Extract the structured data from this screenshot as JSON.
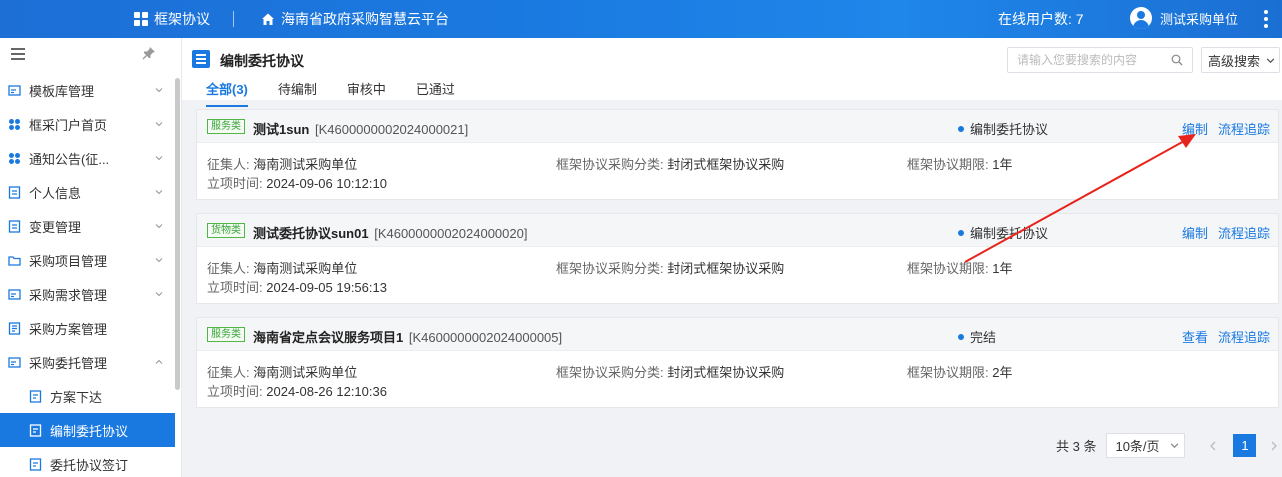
{
  "topbar": {
    "app_name": "框架协议",
    "platform_name": "海南省政府采购智慧云平台",
    "online_users": "在线用户数: 7",
    "user_name": "测试采购单位"
  },
  "sidebar": {
    "items": [
      {
        "label": "模板库管理"
      },
      {
        "label": "框采门户首页"
      },
      {
        "label": "通知公告(征..."
      },
      {
        "label": "个人信息"
      },
      {
        "label": "变更管理"
      },
      {
        "label": "采购项目管理"
      },
      {
        "label": "采购需求管理"
      },
      {
        "label": "采购方案管理"
      },
      {
        "label": "采购委托管理"
      },
      {
        "label": "方案下达"
      },
      {
        "label": "编制委托协议"
      },
      {
        "label": "委托协议签订"
      }
    ]
  },
  "page": {
    "title": "编制委托协议",
    "tabs": [
      "全部(3)",
      "待编制",
      "审核中",
      "已通过"
    ],
    "search_placeholder": "请输入您要搜索的内容",
    "advanced_search": "高级搜索"
  },
  "records": [
    {
      "tag": "服务类",
      "name": "测试1sun",
      "code": "[K4600000002024000021]",
      "status": "编制委托协议",
      "action1": "编制",
      "action2": "流程追踪",
      "collector_label": "征集人:",
      "collector": "海南测试采购单位",
      "category_label": "框架协议采购分类:",
      "category": "封闭式框架协议采购",
      "period_label": "框架协议期限:",
      "period": "1年",
      "time_label": "立项时间:",
      "time": "2024-09-06 10:12:10"
    },
    {
      "tag": "货物类",
      "name": "测试委托协议sun01",
      "code": "[K4600000002024000020]",
      "status": "编制委托协议",
      "action1": "编制",
      "action2": "流程追踪",
      "collector_label": "征集人:",
      "collector": "海南测试采购单位",
      "category_label": "框架协议采购分类:",
      "category": "封闭式框架协议采购",
      "period_label": "框架协议期限:",
      "period": "1年",
      "time_label": "立项时间:",
      "time": "2024-09-05 19:56:13"
    },
    {
      "tag": "服务类",
      "name": "海南省定点会议服务项目1",
      "code": "[K4600000002024000005]",
      "status": "完结",
      "action1": "查看",
      "action2": "流程追踪",
      "collector_label": "征集人:",
      "collector": "海南测试采购单位",
      "category_label": "框架协议采购分类:",
      "category": "封闭式框架协议采购",
      "period_label": "框架协议期限:",
      "period": "2年",
      "time_label": "立项时间:",
      "time": "2024-08-26 12:10:36"
    }
  ],
  "pager": {
    "total": "共 3 条",
    "page_size": "10条/页",
    "current": "1"
  },
  "colors": {
    "primary": "#1a79e0",
    "tag_green": "#3aa33a",
    "annotation_arrow": "#e8231b"
  }
}
